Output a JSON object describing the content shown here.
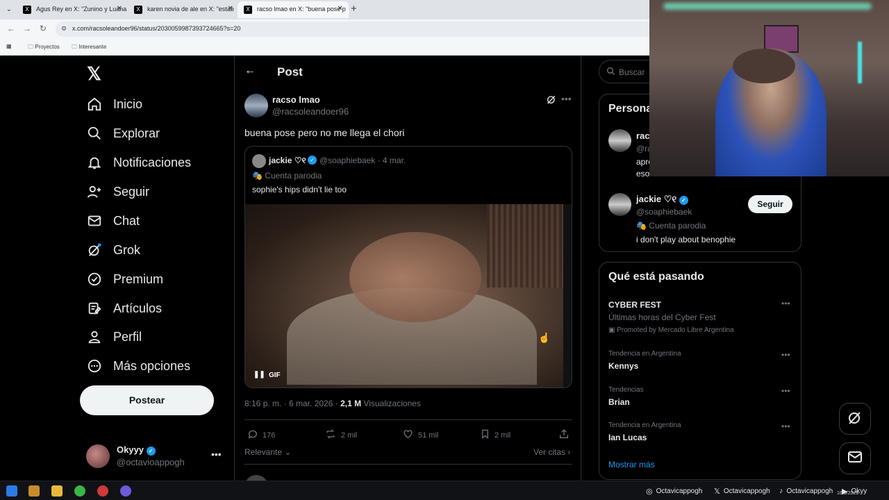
{
  "browser": {
    "tabs": [
      {
        "label": "Agus Rey en X: \"Zunino y Luana"
      },
      {
        "label": "karen novia de ale en X: \"estab"
      },
      {
        "label": "racso lmao en X: \"buena pose p"
      }
    ],
    "url": "x.com/racsoleandoer96/status/2030059987393724665?s=20",
    "bookmarks": [
      "Proyectos",
      "Interesante"
    ]
  },
  "nav": {
    "items": [
      {
        "label": "Inicio",
        "icon": "home-icon"
      },
      {
        "label": "Explorar",
        "icon": "search-icon"
      },
      {
        "label": "Notificaciones",
        "icon": "bell-icon"
      },
      {
        "label": "Seguir",
        "icon": "person-add-icon"
      },
      {
        "label": "Chat",
        "icon": "mail-icon"
      },
      {
        "label": "Grok",
        "icon": "grok-icon"
      },
      {
        "label": "Premium",
        "icon": "verified-icon"
      },
      {
        "label": "Artículos",
        "icon": "article-icon"
      },
      {
        "label": "Perfil",
        "icon": "person-icon"
      },
      {
        "label": "Más opciones",
        "icon": "more-circle-icon"
      }
    ],
    "post_button": "Postear",
    "account": {
      "name": "Okyyy",
      "handle": "@octavioappogh"
    }
  },
  "post": {
    "header_title": "Post",
    "author_name": "racso lmao",
    "author_handle": "@racsoleandoer96",
    "text": "buena pose pero no me llega el chori",
    "quote": {
      "name": "jackie ♡୧",
      "handle_time": "@soaphiebaek · 4 mar.",
      "parody": "Cuenta parodia",
      "text": "sophie's hips didn't lie too",
      "gif_label": "GIF"
    },
    "time": "8:16 p. m. · 6 mar. 2026 · ",
    "views_count": "2,1 M",
    "views_label": " Visualizaciones",
    "actions": {
      "replies": "176",
      "reposts": "2 mil",
      "likes": "51 mil",
      "bookmarks": "2 mil"
    },
    "sort_label": "Relevante",
    "quotes_link": "Ver citas"
  },
  "sidebar": {
    "search_placeholder": "Buscar",
    "suggest_title": "Persona",
    "suggestions": [
      {
        "name": "rac",
        "handle": "@ra",
        "line1": "apre",
        "line2": "eso"
      },
      {
        "name": "jackie ♡୧",
        "handle": "@soaphiebaek",
        "parody": "Cuenta parodia",
        "bio": "i don't play about benophie",
        "button": "Seguir"
      }
    ],
    "trends_title": "Qué está pasando",
    "trends": [
      {
        "name": "CYBER FEST",
        "sub": "Últimas horas del Cyber Fest",
        "promo": "Promoted by Mercado Libre Argentina"
      },
      {
        "context": "Tendencia en Argentina",
        "name": "Kennys"
      },
      {
        "context": "Tendencias",
        "name": "Brian"
      },
      {
        "context": "Tendencia en Argentina",
        "name": "Ian Lucas"
      }
    ],
    "show_more": "Mostrar más"
  },
  "taskbar": {
    "socials": [
      {
        "icon": "instagram-icon",
        "label": "Octavicappogh"
      },
      {
        "icon": "x-icon",
        "label": "Octavicappogh"
      },
      {
        "icon": "tiktok-icon",
        "label": "Octavicappogh"
      },
      {
        "icon": "youtube-icon",
        "label": "Okyy"
      }
    ],
    "date": "16/3/2026"
  },
  "colors": {
    "accent": "#1d9bf0",
    "background": "#000000",
    "text": "#e7e9ea",
    "muted": "#71767b",
    "border": "#2f3336"
  }
}
